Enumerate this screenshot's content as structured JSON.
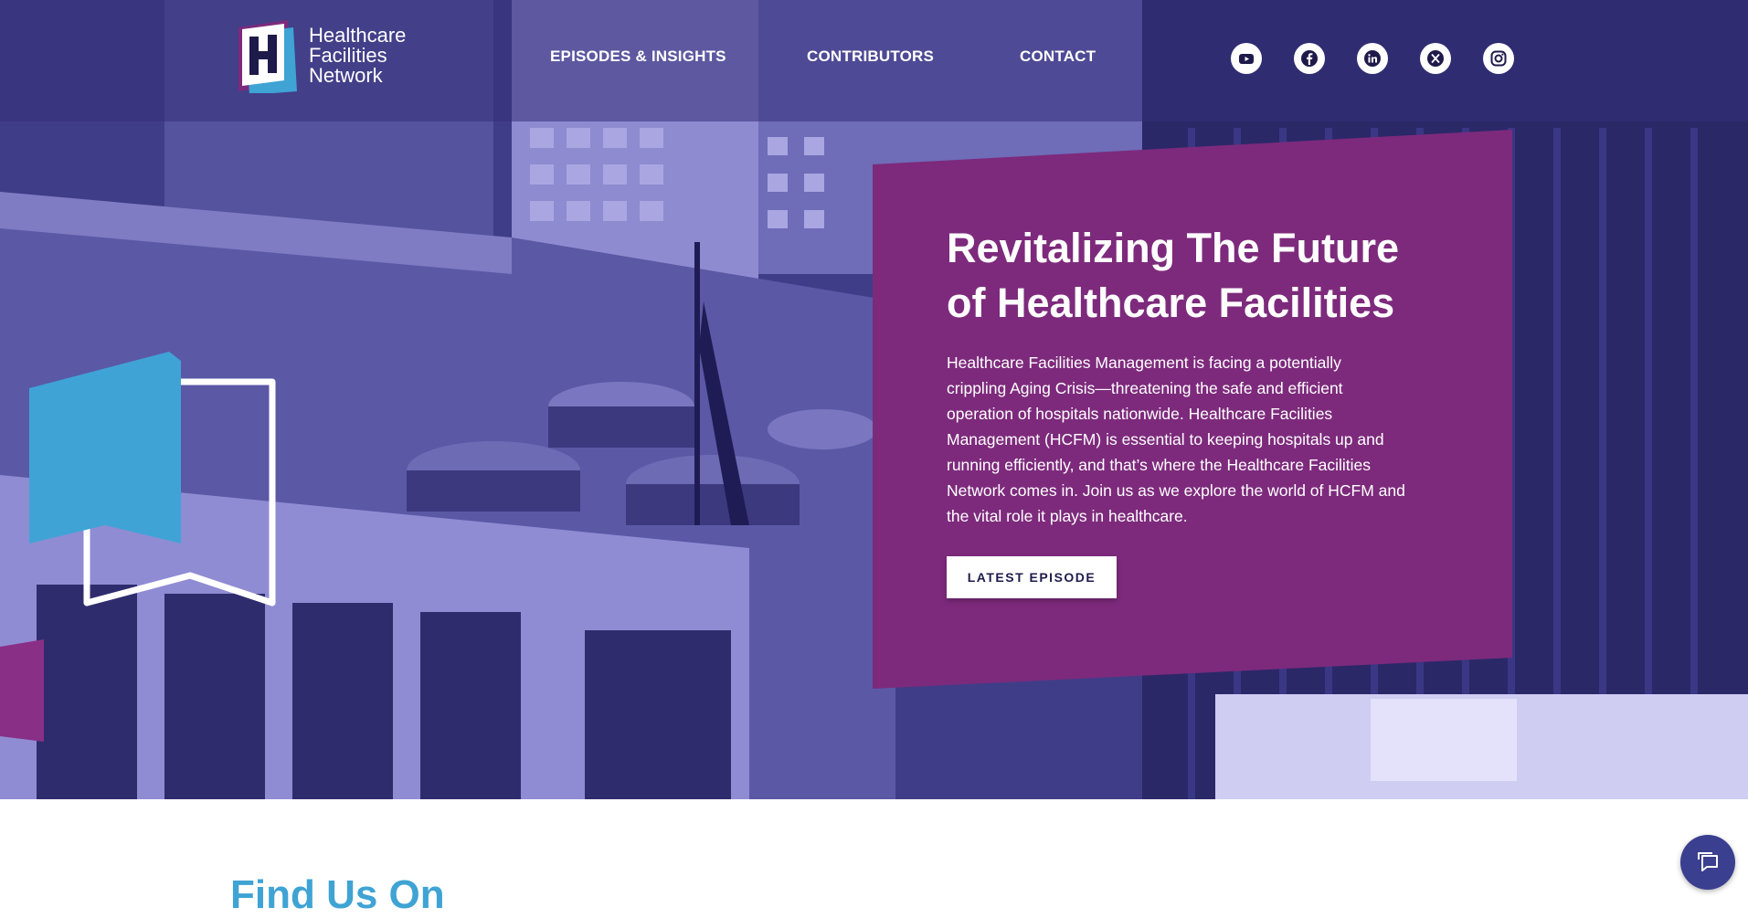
{
  "brand": {
    "logo_lines": [
      "Healthcare",
      "Facilities",
      "Network"
    ]
  },
  "nav": {
    "items": [
      "EPISODES & INSIGHTS",
      "CONTRIBUTORS",
      "CONTACT"
    ]
  },
  "social": {
    "icons": [
      "youtube-icon",
      "facebook-icon",
      "linkedin-icon",
      "x-icon",
      "instagram-icon"
    ]
  },
  "hero": {
    "title_lines": [
      "Revitalizing The Future",
      "of Healthcare Facilities"
    ],
    "body_lines": [
      "Healthcare Facilities Management is facing a potentially",
      "crippling Aging Crisis—threatening the safe and efficient",
      "operation of hospitals nationwide. Healthcare Facilities",
      "Management (HCFM) is essential to keeping hospitals up and",
      "running efficiently, and that’s where the Healthcare Facilities",
      "Network comes in. Join us as we explore the world of HCFM and",
      "the vital role it plays in healthcare."
    ],
    "cta_label": "LATEST EPISODE"
  },
  "section": {
    "heading": "Find Us On"
  },
  "colors": {
    "card_purple": "#7d2a7c",
    "hero_overlay": "#3f3c86",
    "accent_blue": "#3fa3d4",
    "chat_button": "#3b3f8f"
  }
}
